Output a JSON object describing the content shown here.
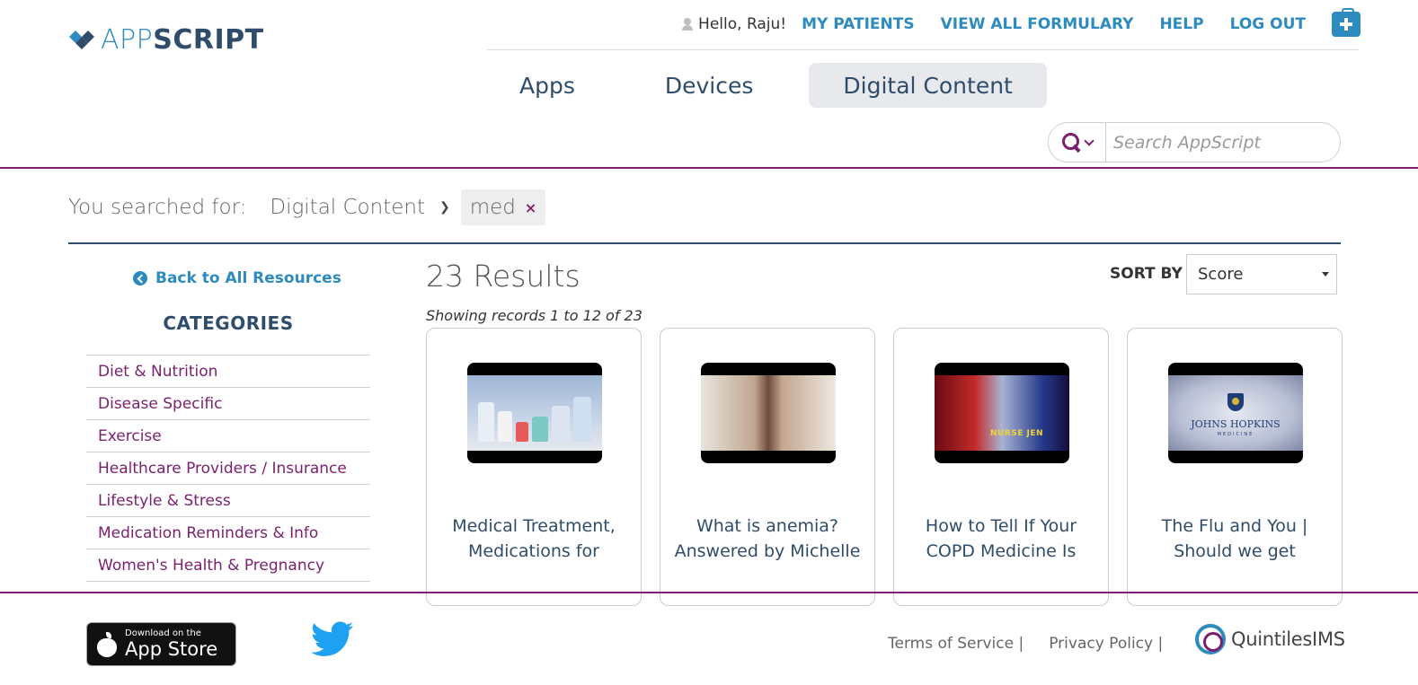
{
  "brand": {
    "logo_part1": "APP",
    "logo_part2": "SCRIPT",
    "accent": "#2e8bc0",
    "secondary": "#2f4d6b",
    "category_color": "#7b1f6e"
  },
  "topnav": {
    "greeting": "Hello, Raju!",
    "links": [
      "MY PATIENTS",
      "VIEW ALL FORMULARY",
      "HELP",
      "LOG OUT"
    ],
    "kit_icon": "medical-kit-icon"
  },
  "tabs": [
    {
      "label": "Apps",
      "active": false
    },
    {
      "label": "Devices",
      "active": false
    },
    {
      "label": "Digital Content",
      "active": true
    }
  ],
  "search": {
    "placeholder": "Search AppScript",
    "value": ""
  },
  "searched_for": {
    "label": "You searched for:",
    "crumb": "Digital Content",
    "chip": "med",
    "chip_remove": "×"
  },
  "sidebar": {
    "back_label": "Back to All Resources",
    "categories_title": "CATEGORIES",
    "categories": [
      "Diet & Nutrition",
      "Disease Specific",
      "Exercise",
      "Healthcare Providers / Insurance",
      "Lifestyle & Stress",
      "Medication Reminders & Info",
      "Women's Health & Pregnancy"
    ]
  },
  "results": {
    "count_label": "23 Results",
    "showing": "Showing records 1 to 12 of 23",
    "sort_label": "SORT BY",
    "sort_value": "Score",
    "cards": [
      {
        "title": "Medical Treatment, Medications for"
      },
      {
        "title": "What is anemia? Answered by Michelle"
      },
      {
        "title": "How to Tell If Your COPD Medicine Is",
        "thumb_text": "NURSE JEN"
      },
      {
        "title": "The Flu and You | Should we get",
        "thumb_text": "JOHNS HOPKINS",
        "thumb_subtext": "MEDICINE"
      }
    ]
  },
  "footer": {
    "appstore_small": "Download on the",
    "appstore_big": "App Store",
    "links": [
      "Terms of Service |",
      "Privacy Policy |"
    ],
    "partner": "QuintilesIMS"
  }
}
